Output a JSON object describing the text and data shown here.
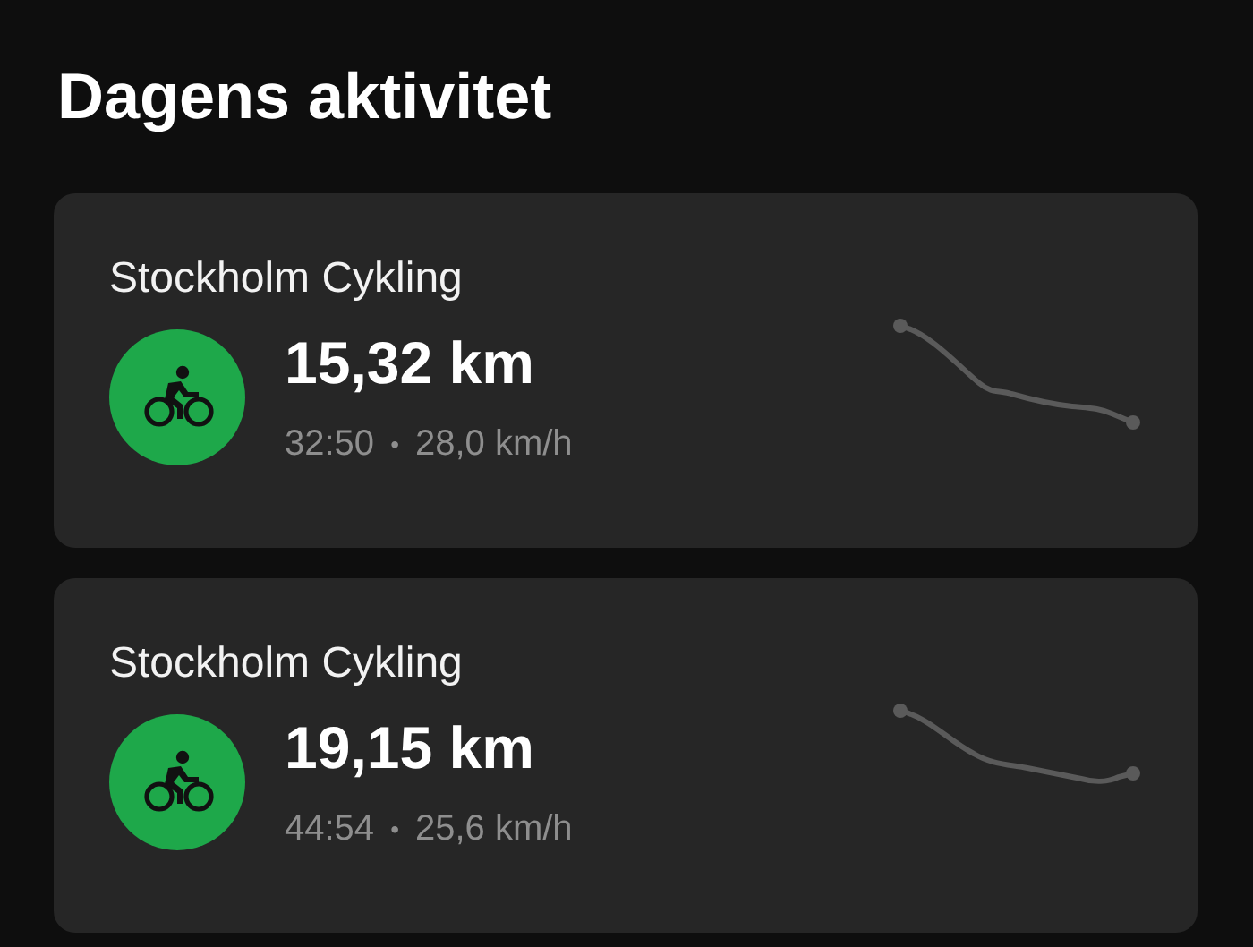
{
  "title": "Dagens aktivitet",
  "activities": [
    {
      "name": "Stockholm Cykling",
      "distance": "15,32 km",
      "duration": "32:50",
      "separator": "•",
      "speed": "28,0 km/h"
    },
    {
      "name": "Stockholm Cykling",
      "distance": "19,15 km",
      "duration": "44:54",
      "separator": "•",
      "speed": "25,6 km/h"
    }
  ]
}
